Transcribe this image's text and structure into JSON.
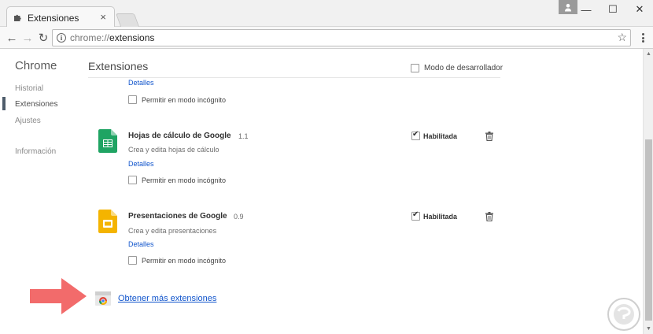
{
  "browser": {
    "tab": {
      "title": "Extensiones",
      "icon": "puzzle-icon",
      "close": "×"
    },
    "window_controls": {
      "minimize": "—",
      "maximize": "☐",
      "close": "✕"
    },
    "toolbar": {
      "back": "←",
      "forward": "→",
      "reload": "↻",
      "url_scheme": "chrome://",
      "url_path": "extensions",
      "star": "☆"
    }
  },
  "sidebar": {
    "title": "Chrome",
    "items": [
      {
        "label": "Historial",
        "active": false
      },
      {
        "label": "Extensiones",
        "active": true
      },
      {
        "label": "Ajustes",
        "active": false
      },
      {
        "label": "Información",
        "active": false
      }
    ]
  },
  "main": {
    "title": "Extensiones",
    "developer_mode": {
      "label": "Modo de desarrollador",
      "checked": false
    },
    "top_partial": {
      "details_link": "Detalles",
      "incognito_label": "Permitir en modo incógnito"
    },
    "extensions": [
      {
        "name": "Hojas de cálculo de Google",
        "version": "1.1",
        "description": "Crea y edita hojas de cálculo",
        "details_link": "Detalles",
        "incognito_label": "Permitir en modo incógnito",
        "enabled_label": "Habilitada",
        "enabled": true,
        "icon": "google-sheets-icon",
        "icon_color": "#1fa463"
      },
      {
        "name": "Presentaciones de Google",
        "version": "0.9",
        "description": "Crea y edita presentaciones",
        "details_link": "Detalles",
        "incognito_label": "Permitir en modo incógnito",
        "enabled_label": "Habilitada",
        "enabled": true,
        "icon": "google-slides-icon",
        "icon_color": "#f4b400"
      }
    ],
    "more_extensions_link": "Obtener más extensiones"
  },
  "colors": {
    "link": "#1155cc",
    "arrow": "#f26b6b",
    "sidebar_active_bar": "#4e5c6b"
  }
}
